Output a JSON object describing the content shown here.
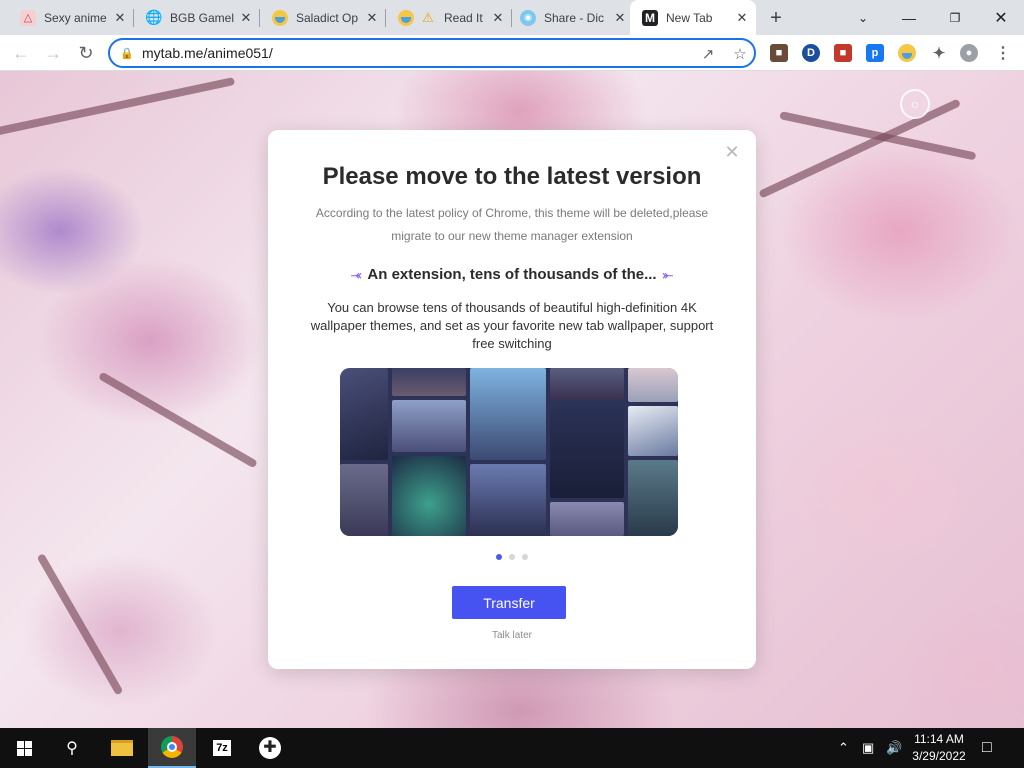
{
  "browser": {
    "tabs": [
      {
        "title": "Sexy anime",
        "icon": "anime-favicon"
      },
      {
        "title": "BGB Gamel",
        "icon": "globe-icon"
      },
      {
        "title": "Saladict Op",
        "icon": "saladict-icon"
      },
      {
        "title": "Read It",
        "icon": "warning-icon"
      },
      {
        "title": "Share - Dic",
        "icon": "share-icon"
      },
      {
        "title": "New Tab",
        "icon": "mytab-icon",
        "favicon_letter": "M"
      }
    ],
    "new_tab_symbol": "+",
    "url": "mytab.me/anime051/"
  },
  "modal": {
    "title": "Please move to the latest version",
    "policy_text": "According to the latest policy of Chrome, this theme will be deleted,please migrate to our new theme manager extension",
    "feature_title": "An extension, tens of thousands of the...",
    "feature_description": "You can browse tens of thousands of beautiful high-definition 4K wallpaper themes, and set as your favorite new tab wallpaper, support free switching",
    "carousel_dots": 3,
    "active_dot": 0,
    "primary_button": "Transfer",
    "secondary_link": "Talk later"
  },
  "taskbar": {
    "time": "11:14 AM",
    "date": "3/29/2022",
    "apps": [
      "file-explorer",
      "chrome",
      "7zip",
      "gamepad"
    ],
    "seven_zip_label": "7z"
  },
  "colors": {
    "accent": "#4653f0",
    "omnibox_focus": "#1a73e8",
    "taskbar": "#101010"
  }
}
